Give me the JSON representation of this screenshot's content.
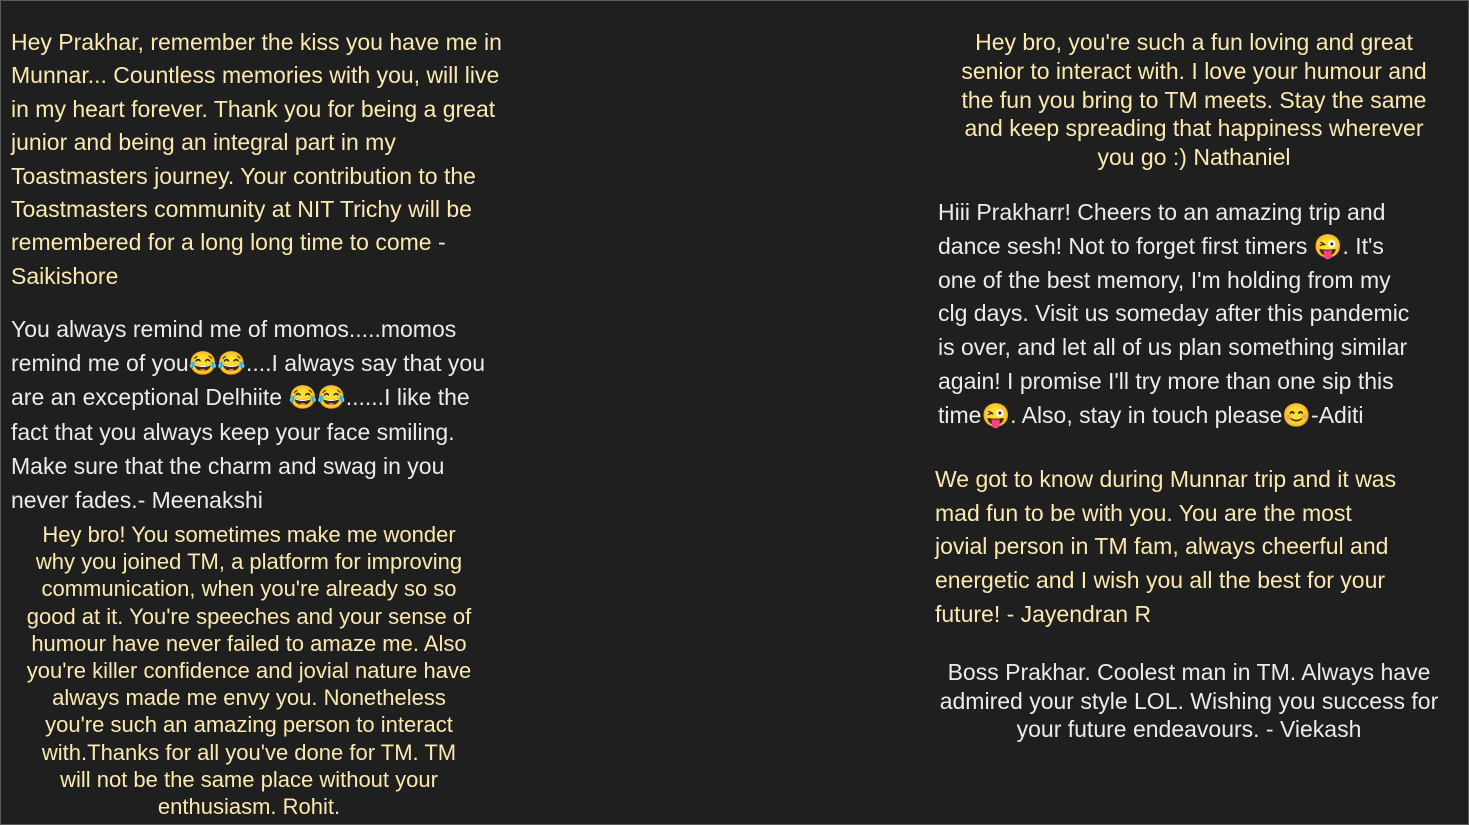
{
  "messages": {
    "saikishore": " Hey Prakhar, remember the kiss you have me in\nMunnar... Countless memories with you, will live\nin my heart forever. Thank you for being a great\njunior and being an integral part in my\nToastmasters journey. Your contribution to the\nToastmasters community at NIT Trichy will be\nremembered for a long long time to come -\nSaikishore",
    "meenakshi": "You always remind me of momos.....momos\nremind me of you😂😂....I always say that you\nare an exceptional Delhiite 😂😂......I like the\nfact that you always keep your face smiling.\nMake sure that the charm and swag in you\nnever fades.- Meenakshi",
    "rohit": "Hey bro! You sometimes make me wonder\nwhy you joined TM, a platform for improving\ncommunication, when you're already so so\ngood at it. You're speeches and your sense of\nhumour have never failed to amaze me. Also\nyou're killer confidence and jovial nature have\nalways made me envy you. Nonetheless\nyou're such an amazing person to interact\nwith.Thanks for all you've done for TM. TM\nwill not be the same place without your\nenthusiasm. Rohit.",
    "nathaniel": "Hey bro, you're such a fun loving and great\nsenior to interact with. I love your humour and\nthe fun you bring to TM meets. Stay the same\nand keep spreading that happiness wherever\nyou go :) Nathaniel",
    "aditi": "Hiii Prakharr! Cheers to an amazing trip and\ndance sesh! Not to forget first timers 😜. It's\none of the best memory, I'm holding from my\nclg days. Visit us someday after this pandemic\nis over, and let all of us plan something similar\nagain! I promise I'll try more than one sip this\ntime😜. Also, stay in touch please😊-Aditi",
    "jayendran": " We got to know during Munnar trip and it was\nmad fun to be with you. You are the most\njovial person in TM fam, always cheerful and\nenergetic and I wish you all the best for your\nfuture! - Jayendran R",
    "viekash": "Boss Prakhar. Coolest man in TM. Always have\nadmired your style LOL. Wishing you success for\nyour future endeavours. - Viekash"
  },
  "colors": {
    "background": "#1f1f1f",
    "text_yellow": "#fbe9b0",
    "text_white": "#ececec"
  }
}
